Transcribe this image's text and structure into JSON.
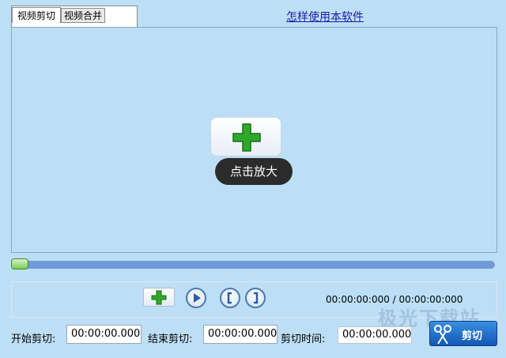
{
  "tabs": [
    {
      "label": "视频剪切",
      "active": true
    },
    {
      "label": "视频合并",
      "active": false
    }
  ],
  "help_link": "怎样使用本软件",
  "preview": {
    "zoom_tooltip": "点击放大"
  },
  "progress": {
    "position": 0
  },
  "controls": {
    "timecode": "00:00:00:000 / 00:00:00:000"
  },
  "cut": {
    "start_label": "开始剪切:",
    "start_value": "00:00:00.000",
    "end_label": "结束剪切:",
    "end_value": "00:00:00.000",
    "duration_label": "剪切时间:",
    "duration_value": "00:00:00.000",
    "button_label": "剪切"
  },
  "watermark": "极光下载站",
  "colors": {
    "background": "#bcdff6",
    "accent": "#1457b8",
    "progress": "#6f99d9"
  }
}
